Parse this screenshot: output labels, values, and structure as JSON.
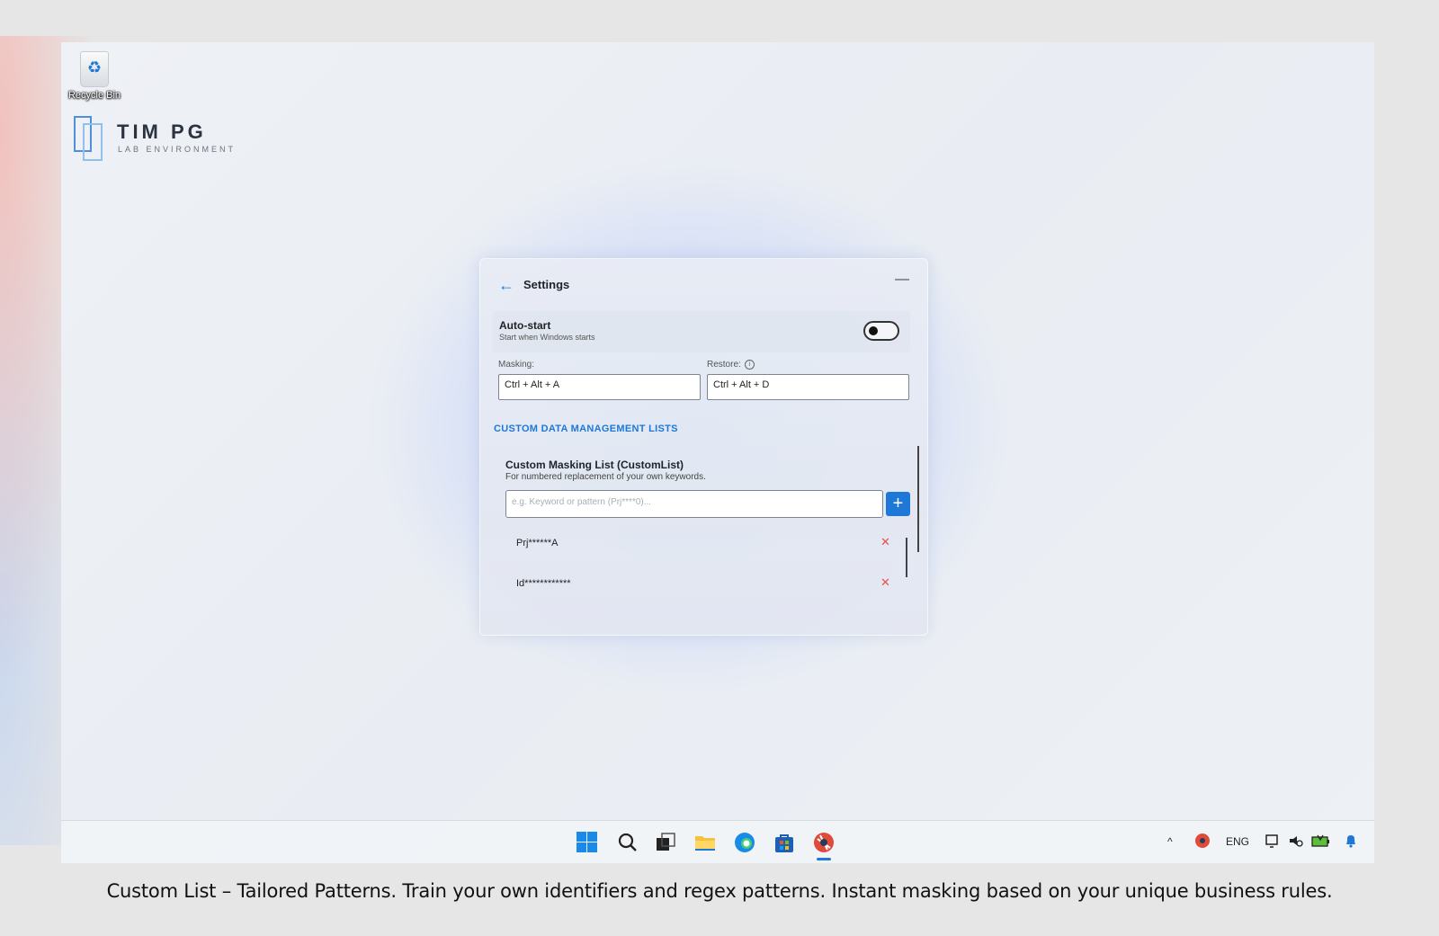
{
  "desktop": {
    "recycle_bin_label": "Recycle Bin",
    "logo": {
      "title": "TIM PG",
      "subtitle": "LAB ENVIRONMENT"
    }
  },
  "settings": {
    "title": "Settings",
    "auto_start": {
      "label": "Auto-start",
      "description": "Start when Windows starts",
      "enabled": false
    },
    "masking": {
      "label": "Masking:",
      "value": "Ctrl + Alt + A"
    },
    "restore": {
      "label": "Restore:",
      "value": "Ctrl + Alt + D"
    },
    "section_title": "CUSTOM DATA MANAGEMENT LISTS",
    "custom_list": {
      "title": "Custom Masking List (CustomList)",
      "description": "For numbered replacement of your own keywords.",
      "input_placeholder": "e.g. Keyword or pattern (Prj****0)...",
      "add_symbol": "+",
      "items": [
        "Prj******A",
        "Id************"
      ],
      "delete_symbol": "✕"
    }
  },
  "taskbar": {
    "apps": [
      "start-icon",
      "search-icon",
      "task-view-icon",
      "file-explorer-icon",
      "edge-icon",
      "store-icon",
      "masking-app-icon"
    ],
    "tray": {
      "chevron": "^",
      "language": "ENG"
    },
    "accent": "#1e78d8"
  },
  "caption": "Custom List – Tailored Patterns. Train your own identifiers and regex patterns. Instant masking based on your unique business rules."
}
